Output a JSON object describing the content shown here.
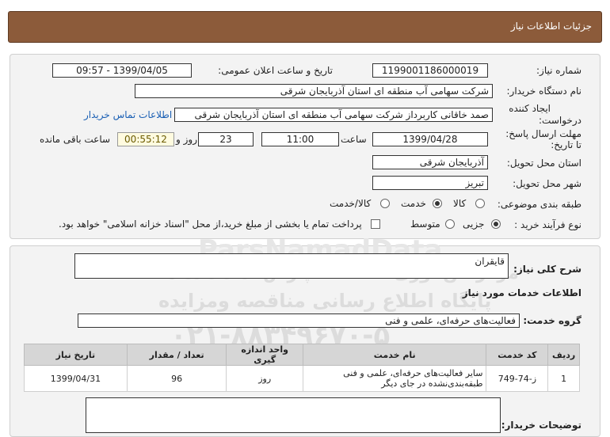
{
  "header": {
    "title": "جزئیات اطلاعات نیاز"
  },
  "form": {
    "need_number_label": "شماره نیاز:",
    "need_number": "1199001186000019",
    "announce_label": "تاریخ و ساعت اعلان عمومی:",
    "announce_value": "1399/04/05 - 09:57",
    "buyer_org_label": "نام دستگاه خریدار:",
    "buyer_org": "شرکت سهامی آب منطقه ای استان آذربایجان شرقی",
    "creator_label_1": "ایجاد کننده",
    "creator_label_2": "درخواست:",
    "creator": "صمد خاقانی کاربرداز شرکت سهامی آب منطقه ای استان آذربایجان شرقی",
    "contact_link": "اطلاعات تماس خریدار",
    "deadline_label_1": "مهلت ارسال پاسخ:",
    "deadline_label_2": "تا تاریخ:",
    "deadline_date": "1399/04/28",
    "time_label": "ساعت",
    "deadline_time": "11:00",
    "days_value": "23",
    "days_label": "روز و",
    "remaining_time": "00:55:12",
    "remaining_label": "ساعت باقی مانده",
    "province_label": "استان محل تحویل:",
    "province": "آذربایجان شرقی",
    "city_label": "شهر محل تحویل:",
    "city": "تبریز",
    "category_label": "طبقه بندی موضوعی:",
    "category_options": [
      "کالا",
      "خدمت",
      "کالا/خدمت"
    ],
    "category_selected": "خدمت",
    "process_label": "نوع فرآیند خرید :",
    "process_options": [
      "جزیی",
      "متوسط"
    ],
    "process_selected": "جزیی",
    "payment_note": "پرداخت تمام یا بخشی از مبلغ خرید،از محل \"اسناد خزانه اسلامی\" خواهد بود."
  },
  "details": {
    "summary_label": "شرح کلی نیاز:",
    "summary": "قایقران",
    "services_title": "اطلاعات خدمات مورد نیاز",
    "service_group_label": "گروه خدمت:",
    "service_group": "فعالیت‌های حرفه‌ای، علمی و فنی",
    "table": {
      "headers": [
        "ردیف",
        "کد خدمت",
        "نام خدمت",
        "واحد اندازه گیری",
        "تعداد / مقدار",
        "تاریخ نیاز"
      ],
      "rows": [
        [
          "1",
          "ز-74-749",
          "سایر فعالیت‌های حرفه‌ای، علمی و فنی طبقه‌بندی‌نشده در جای دیگر",
          "روز",
          "96",
          "1399/04/31"
        ]
      ]
    },
    "buyer_notes_label": "توضیحات خریدار:",
    "buyer_notes": ""
  },
  "watermark": {
    "brand": "ParsNamadData",
    "line1": "مرکز فن آوری اطلاعات پارس نماد داده ها",
    "line2": "پایگاه اطلاع رسانی مناقصه ومزایده",
    "phone": "۰۲۱-۸۸۳۴۹۶۷۰-۵"
  }
}
